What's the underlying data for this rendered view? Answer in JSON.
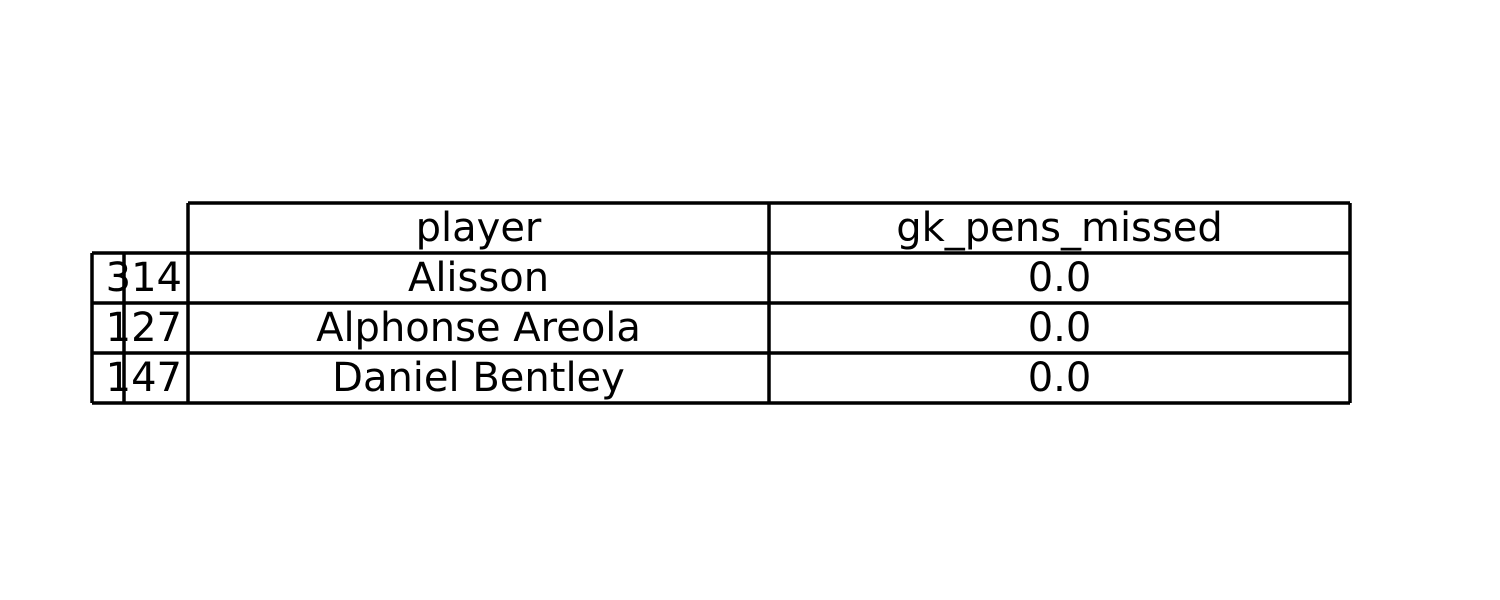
{
  "chart_data": {
    "type": "table",
    "columns": [
      "player",
      "gk_pens_missed"
    ],
    "rows": [
      {
        "index": "314",
        "player": "Alisson",
        "gk_pens_missed": "0.0"
      },
      {
        "index": "127",
        "player": "Alphonse Areola",
        "gk_pens_missed": "0.0"
      },
      {
        "index": "147",
        "player": "Daniel Bentley",
        "gk_pens_missed": "0.0"
      }
    ]
  },
  "colors": {
    "border": "#000000",
    "text": "#000000",
    "background": "#ffffff"
  }
}
